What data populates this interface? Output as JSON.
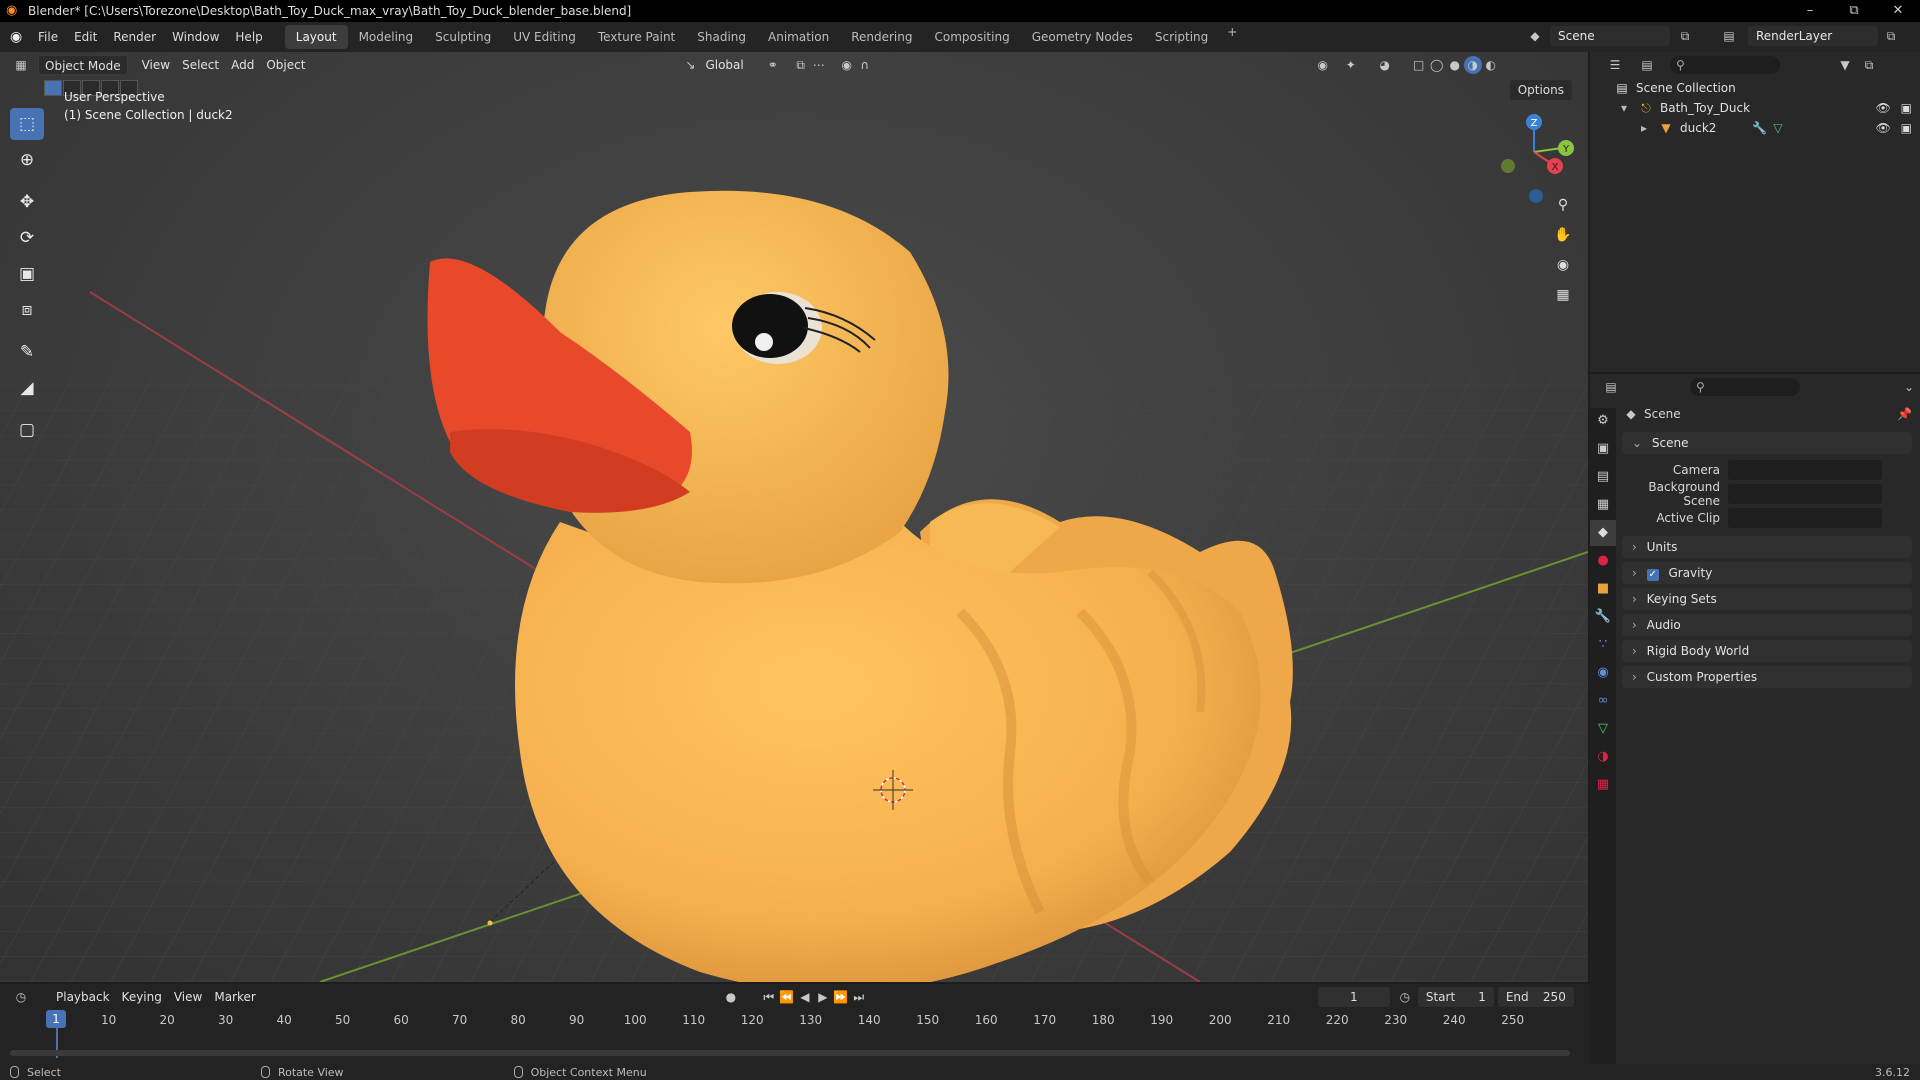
{
  "window": {
    "title": "Blender* [C:\\Users\\Torezone\\Desktop\\Bath_Toy_Duck_max_vray\\Bath_Toy_Duck_blender_base.blend]",
    "controls": [
      "–",
      "⧉",
      "✕"
    ]
  },
  "menu": [
    "File",
    "Edit",
    "Render",
    "Window",
    "Help"
  ],
  "workspaces": [
    "Layout",
    "Modeling",
    "Sculpting",
    "UV Editing",
    "Texture Paint",
    "Shading",
    "Animation",
    "Rendering",
    "Compositing",
    "Geometry Nodes",
    "Scripting"
  ],
  "active_workspace": "Layout",
  "scene_name": "Scene",
  "view_layer": "RenderLayer",
  "viewport": {
    "mode": "Object Mode",
    "menus": [
      "View",
      "Select",
      "Add",
      "Object"
    ],
    "orientation": "Global",
    "options_label": "Options",
    "perspective_label": "User Perspective",
    "collection_label": "(1) Scene Collection | duck2",
    "gizmo": {
      "x": "X",
      "y": "Y",
      "z": "Z"
    },
    "colors": {
      "duck_body": "#f5b04d",
      "beak": "#e84a2a",
      "x_axis": "#e5414f",
      "y_axis": "#8bc53f",
      "z_axis": "#3b82d6",
      "selection": "#4772b3"
    }
  },
  "outliner": {
    "root": "Scene Collection",
    "items": [
      {
        "label": "Bath_Toy_Duck",
        "icon": "empty-icon"
      },
      {
        "label": "duck2",
        "icon": "mesh-icon"
      }
    ]
  },
  "properties": {
    "header": "Scene",
    "section": "Scene",
    "fields": [
      {
        "label": "Camera",
        "value": ""
      },
      {
        "label": "Background Scene",
        "value": ""
      },
      {
        "label": "Active Clip",
        "value": ""
      }
    ],
    "panels": [
      "Units",
      "Gravity",
      "Keying Sets",
      "Audio",
      "Rigid Body World",
      "Custom Properties"
    ],
    "gravity_checked": true
  },
  "timeline": {
    "menus": [
      "Playback",
      "Keying",
      "View",
      "Marker"
    ],
    "current_frame": "1",
    "start_label": "Start",
    "start": "1",
    "end_label": "End",
    "end": "250",
    "ticks": [
      "10",
      "20",
      "30",
      "40",
      "50",
      "60",
      "70",
      "80",
      "90",
      "100",
      "110",
      "120",
      "130",
      "140",
      "150",
      "160",
      "170",
      "180",
      "190",
      "200",
      "210",
      "220",
      "230",
      "240",
      "250"
    ]
  },
  "statusbar": {
    "items": [
      "Select",
      "Rotate View",
      "Object Context Menu"
    ],
    "version": "3.6.12"
  }
}
